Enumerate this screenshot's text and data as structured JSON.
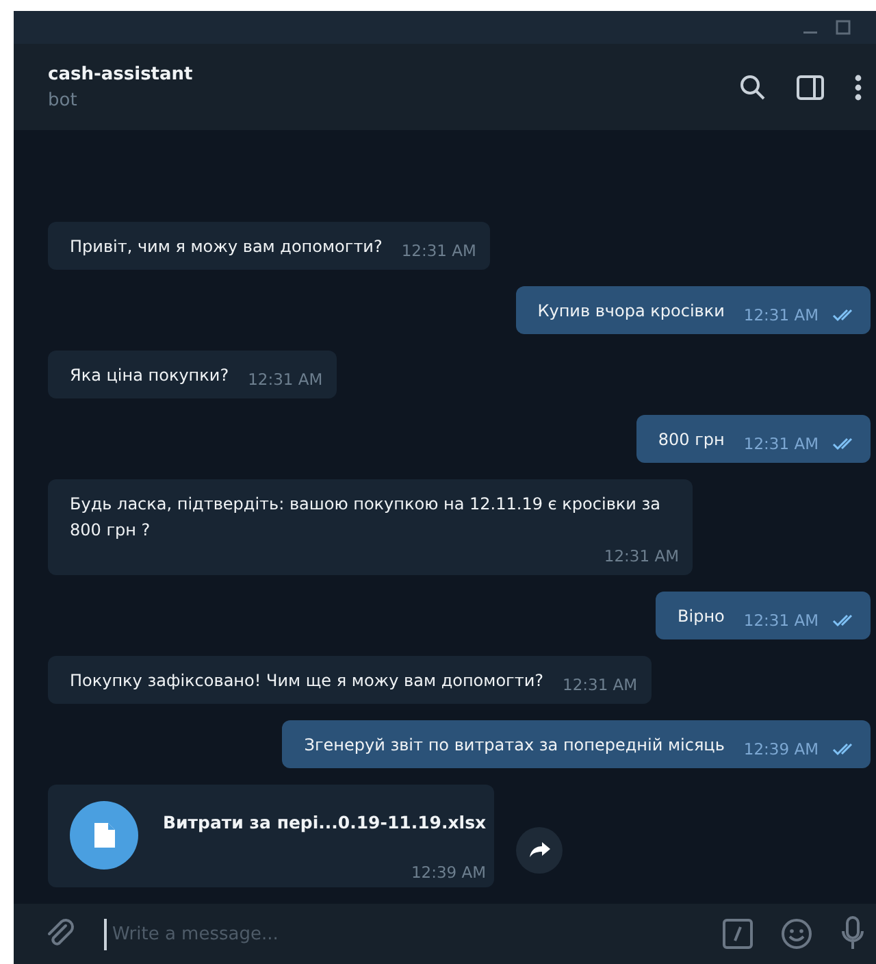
{
  "window": {
    "title": "cash-assistant",
    "subtitle": "bot"
  },
  "messages": [
    {
      "kind": "in",
      "text": "Привіт, чим я можу вам допомогти?",
      "time": "12:31 AM"
    },
    {
      "kind": "out",
      "text": "Купив вчора кросівки",
      "time": "12:31 AM",
      "read": true
    },
    {
      "kind": "in",
      "text": "Яка ціна покупки?",
      "time": "12:31 AM"
    },
    {
      "kind": "out",
      "text": "800 грн",
      "time": "12:31 AM",
      "read": true
    },
    {
      "kind": "in",
      "text": "Будь ласка, підтвердіть: вашою покупкою на 12.11.19 є кросівки за 800 грн ?",
      "time": "12:31 AM",
      "multiline": true
    },
    {
      "kind": "out",
      "text": "Вірно",
      "time": "12:31 AM",
      "read": true
    },
    {
      "kind": "in",
      "text": "Покупку зафіксовано! Чим ще я можу вам допомогти?",
      "time": "12:31 AM"
    },
    {
      "kind": "out",
      "text": "Згенеруй звіт по витратах за попередній місяць",
      "time": "12:39 AM",
      "read": true
    },
    {
      "kind": "file",
      "text": "Витрати за пері...0.19-11.19.xlsx",
      "time": "12:39 AM"
    }
  ],
  "composer": {
    "placeholder": "Write a message..."
  }
}
